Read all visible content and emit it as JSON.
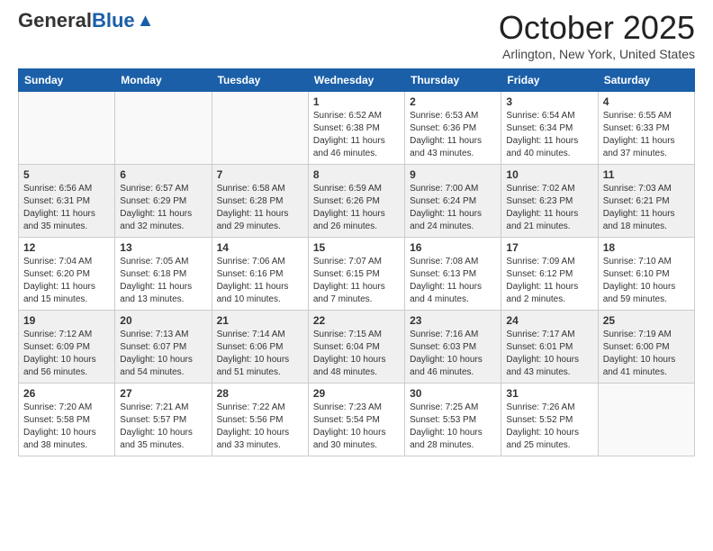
{
  "header": {
    "logo_general": "General",
    "logo_blue": "Blue",
    "month_title": "October 2025",
    "subtitle": "Arlington, New York, United States"
  },
  "days_of_week": [
    "Sunday",
    "Monday",
    "Tuesday",
    "Wednesday",
    "Thursday",
    "Friday",
    "Saturday"
  ],
  "weeks": [
    [
      {
        "day": "",
        "info": ""
      },
      {
        "day": "",
        "info": ""
      },
      {
        "day": "",
        "info": ""
      },
      {
        "day": "1",
        "info": "Sunrise: 6:52 AM\nSunset: 6:38 PM\nDaylight: 11 hours and 46 minutes."
      },
      {
        "day": "2",
        "info": "Sunrise: 6:53 AM\nSunset: 6:36 PM\nDaylight: 11 hours and 43 minutes."
      },
      {
        "day": "3",
        "info": "Sunrise: 6:54 AM\nSunset: 6:34 PM\nDaylight: 11 hours and 40 minutes."
      },
      {
        "day": "4",
        "info": "Sunrise: 6:55 AM\nSunset: 6:33 PM\nDaylight: 11 hours and 37 minutes."
      }
    ],
    [
      {
        "day": "5",
        "info": "Sunrise: 6:56 AM\nSunset: 6:31 PM\nDaylight: 11 hours and 35 minutes."
      },
      {
        "day": "6",
        "info": "Sunrise: 6:57 AM\nSunset: 6:29 PM\nDaylight: 11 hours and 32 minutes."
      },
      {
        "day": "7",
        "info": "Sunrise: 6:58 AM\nSunset: 6:28 PM\nDaylight: 11 hours and 29 minutes."
      },
      {
        "day": "8",
        "info": "Sunrise: 6:59 AM\nSunset: 6:26 PM\nDaylight: 11 hours and 26 minutes."
      },
      {
        "day": "9",
        "info": "Sunrise: 7:00 AM\nSunset: 6:24 PM\nDaylight: 11 hours and 24 minutes."
      },
      {
        "day": "10",
        "info": "Sunrise: 7:02 AM\nSunset: 6:23 PM\nDaylight: 11 hours and 21 minutes."
      },
      {
        "day": "11",
        "info": "Sunrise: 7:03 AM\nSunset: 6:21 PM\nDaylight: 11 hours and 18 minutes."
      }
    ],
    [
      {
        "day": "12",
        "info": "Sunrise: 7:04 AM\nSunset: 6:20 PM\nDaylight: 11 hours and 15 minutes."
      },
      {
        "day": "13",
        "info": "Sunrise: 7:05 AM\nSunset: 6:18 PM\nDaylight: 11 hours and 13 minutes."
      },
      {
        "day": "14",
        "info": "Sunrise: 7:06 AM\nSunset: 6:16 PM\nDaylight: 11 hours and 10 minutes."
      },
      {
        "day": "15",
        "info": "Sunrise: 7:07 AM\nSunset: 6:15 PM\nDaylight: 11 hours and 7 minutes."
      },
      {
        "day": "16",
        "info": "Sunrise: 7:08 AM\nSunset: 6:13 PM\nDaylight: 11 hours and 4 minutes."
      },
      {
        "day": "17",
        "info": "Sunrise: 7:09 AM\nSunset: 6:12 PM\nDaylight: 11 hours and 2 minutes."
      },
      {
        "day": "18",
        "info": "Sunrise: 7:10 AM\nSunset: 6:10 PM\nDaylight: 10 hours and 59 minutes."
      }
    ],
    [
      {
        "day": "19",
        "info": "Sunrise: 7:12 AM\nSunset: 6:09 PM\nDaylight: 10 hours and 56 minutes."
      },
      {
        "day": "20",
        "info": "Sunrise: 7:13 AM\nSunset: 6:07 PM\nDaylight: 10 hours and 54 minutes."
      },
      {
        "day": "21",
        "info": "Sunrise: 7:14 AM\nSunset: 6:06 PM\nDaylight: 10 hours and 51 minutes."
      },
      {
        "day": "22",
        "info": "Sunrise: 7:15 AM\nSunset: 6:04 PM\nDaylight: 10 hours and 48 minutes."
      },
      {
        "day": "23",
        "info": "Sunrise: 7:16 AM\nSunset: 6:03 PM\nDaylight: 10 hours and 46 minutes."
      },
      {
        "day": "24",
        "info": "Sunrise: 7:17 AM\nSunset: 6:01 PM\nDaylight: 10 hours and 43 minutes."
      },
      {
        "day": "25",
        "info": "Sunrise: 7:19 AM\nSunset: 6:00 PM\nDaylight: 10 hours and 41 minutes."
      }
    ],
    [
      {
        "day": "26",
        "info": "Sunrise: 7:20 AM\nSunset: 5:58 PM\nDaylight: 10 hours and 38 minutes."
      },
      {
        "day": "27",
        "info": "Sunrise: 7:21 AM\nSunset: 5:57 PM\nDaylight: 10 hours and 35 minutes."
      },
      {
        "day": "28",
        "info": "Sunrise: 7:22 AM\nSunset: 5:56 PM\nDaylight: 10 hours and 33 minutes."
      },
      {
        "day": "29",
        "info": "Sunrise: 7:23 AM\nSunset: 5:54 PM\nDaylight: 10 hours and 30 minutes."
      },
      {
        "day": "30",
        "info": "Sunrise: 7:25 AM\nSunset: 5:53 PM\nDaylight: 10 hours and 28 minutes."
      },
      {
        "day": "31",
        "info": "Sunrise: 7:26 AM\nSunset: 5:52 PM\nDaylight: 10 hours and 25 minutes."
      },
      {
        "day": "",
        "info": ""
      }
    ]
  ]
}
